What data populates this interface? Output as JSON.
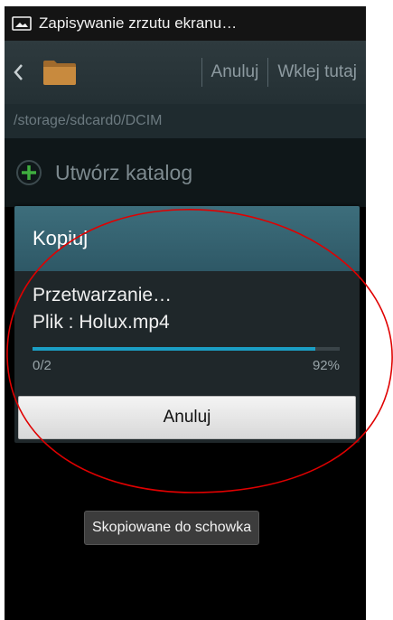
{
  "status_bar": {
    "notification": "Zapisywanie zrzutu ekranu…",
    "icon": "screenshot-icon"
  },
  "action_bar": {
    "back_icon": "chevron-left-icon",
    "folder_icon": "folder-icon",
    "cancel_label": "Anuluj",
    "paste_label": "Wklej tutaj"
  },
  "path": "/storage/sdcard0/DCIM",
  "create_folder": {
    "icon": "plus-circle-icon",
    "label": "Utwórz katalog"
  },
  "dialog": {
    "title": "Kopiuj",
    "processing": "Przetwarzanie…",
    "file_prefix": "Plik : ",
    "file_name": "Holux.mp4",
    "file_line": "Plik : Holux.mp4",
    "count": "0/2",
    "percent": "92%",
    "progress_fraction": 0.92,
    "cancel_label": "Anuluj"
  },
  "toast": "Skopiowane do schowka",
  "colors": {
    "accent": "#1b9ec4",
    "dialog_title_bg": "#3d6e7c",
    "annotation": "#e00000"
  }
}
